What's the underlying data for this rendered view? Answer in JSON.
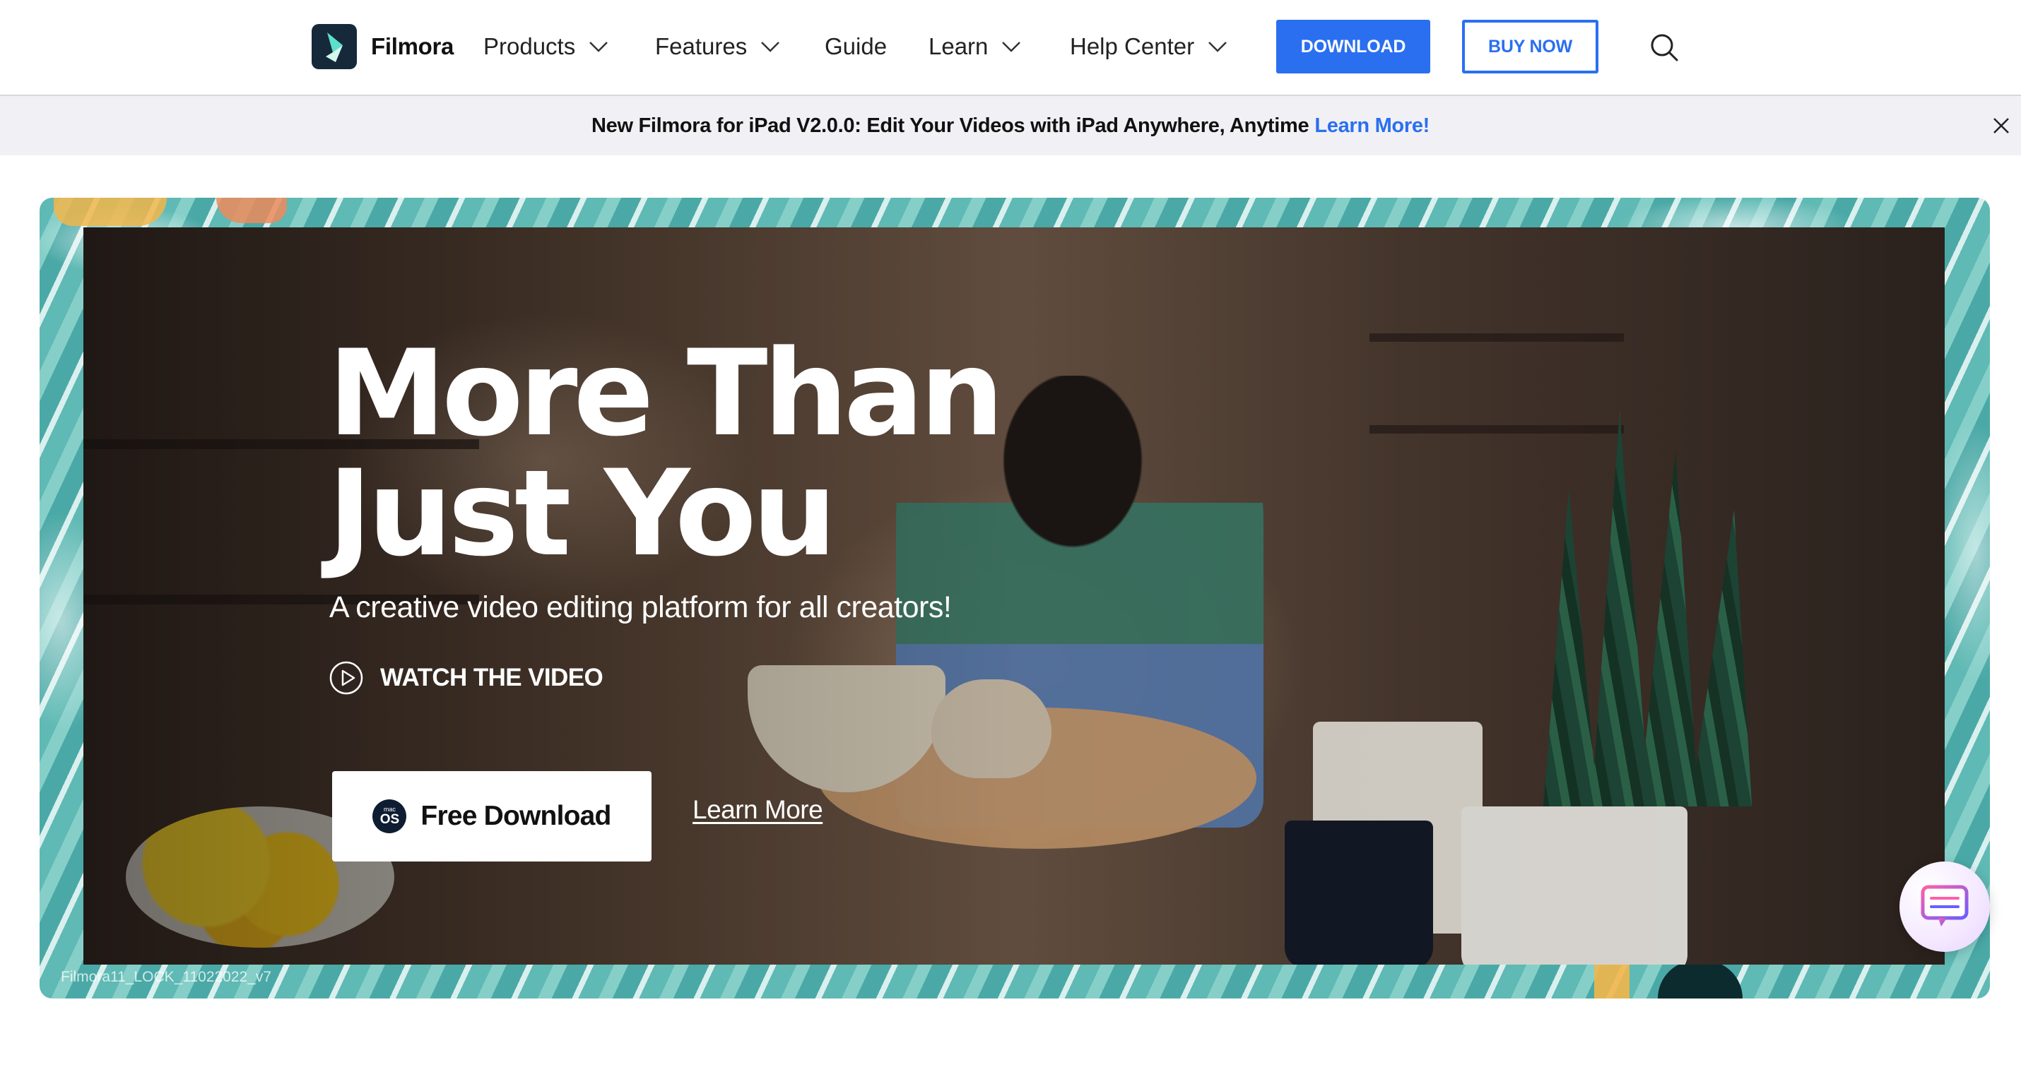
{
  "nav": {
    "brand": "Filmora",
    "items": [
      {
        "label": "Products",
        "has_dropdown": true
      },
      {
        "label": "Features",
        "has_dropdown": true
      },
      {
        "label": "Guide",
        "has_dropdown": false
      },
      {
        "label": "Learn",
        "has_dropdown": true
      },
      {
        "label": "Help Center",
        "has_dropdown": true
      }
    ],
    "download_label": "DOWNLOAD",
    "buy_now_label": "BUY NOW",
    "search_icon": "search-icon",
    "accent_color": "#2a6ff0"
  },
  "announcement": {
    "text": "New Filmora for iPad V2.0.0: Edit Your Videos with iPad Anywhere, Anytime",
    "link": "Learn More!",
    "close_icon": "close-icon"
  },
  "hero": {
    "title_line1": "More Than",
    "title_line2": "Just You",
    "subtitle": "A creative video editing platform for all creators!",
    "watch_label": "WATCH THE VIDEO",
    "free_download_label": "Free Download",
    "os_badge_top": "mac",
    "os_badge_bottom": "OS",
    "learn_more_label": "Learn More",
    "watermark": "Filmora11_LOCK_11022022_v7",
    "frame_color": "#63bdb8"
  },
  "chat_widget": {
    "icon": "chat-icon"
  }
}
